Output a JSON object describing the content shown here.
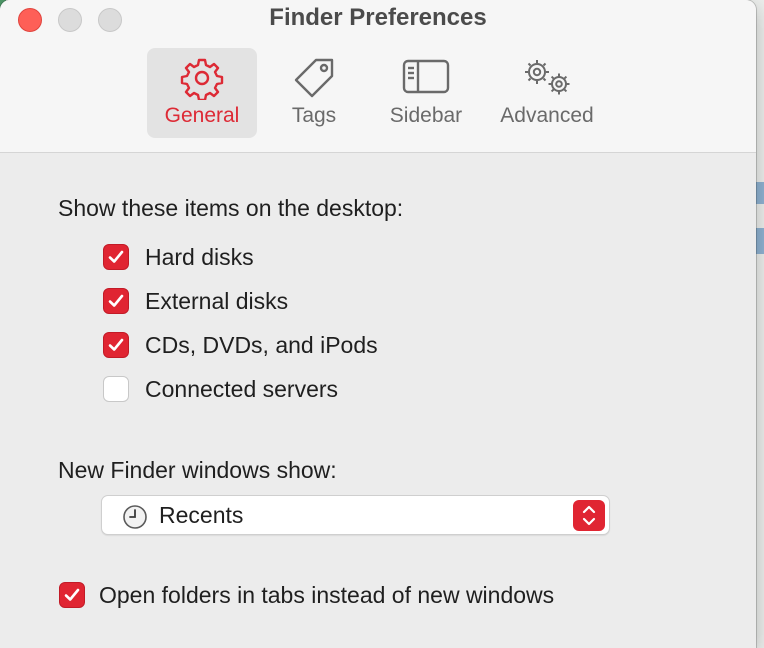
{
  "window": {
    "title": "Finder Preferences"
  },
  "tabs": [
    {
      "label": "General",
      "icon": "gear-icon",
      "selected": true
    },
    {
      "label": "Tags",
      "icon": "tag-icon",
      "selected": false
    },
    {
      "label": "Sidebar",
      "icon": "sidebar-icon",
      "selected": false
    },
    {
      "label": "Advanced",
      "icon": "gears-icon",
      "selected": false
    }
  ],
  "desktop": {
    "heading": "Show these items on the desktop:",
    "items": [
      {
        "label": "Hard disks",
        "checked": true
      },
      {
        "label": "External disks",
        "checked": true
      },
      {
        "label": "CDs, DVDs, and iPods",
        "checked": true
      },
      {
        "label": "Connected servers",
        "checked": false
      }
    ]
  },
  "new_window": {
    "heading": "New Finder windows show:",
    "selected": "Recents",
    "icon": "clock-icon"
  },
  "tabs_option": {
    "label": "Open folders in tabs instead of new windows",
    "checked": true
  },
  "colors": {
    "accent": "#e02532",
    "accent_text": "#dd2a35"
  }
}
